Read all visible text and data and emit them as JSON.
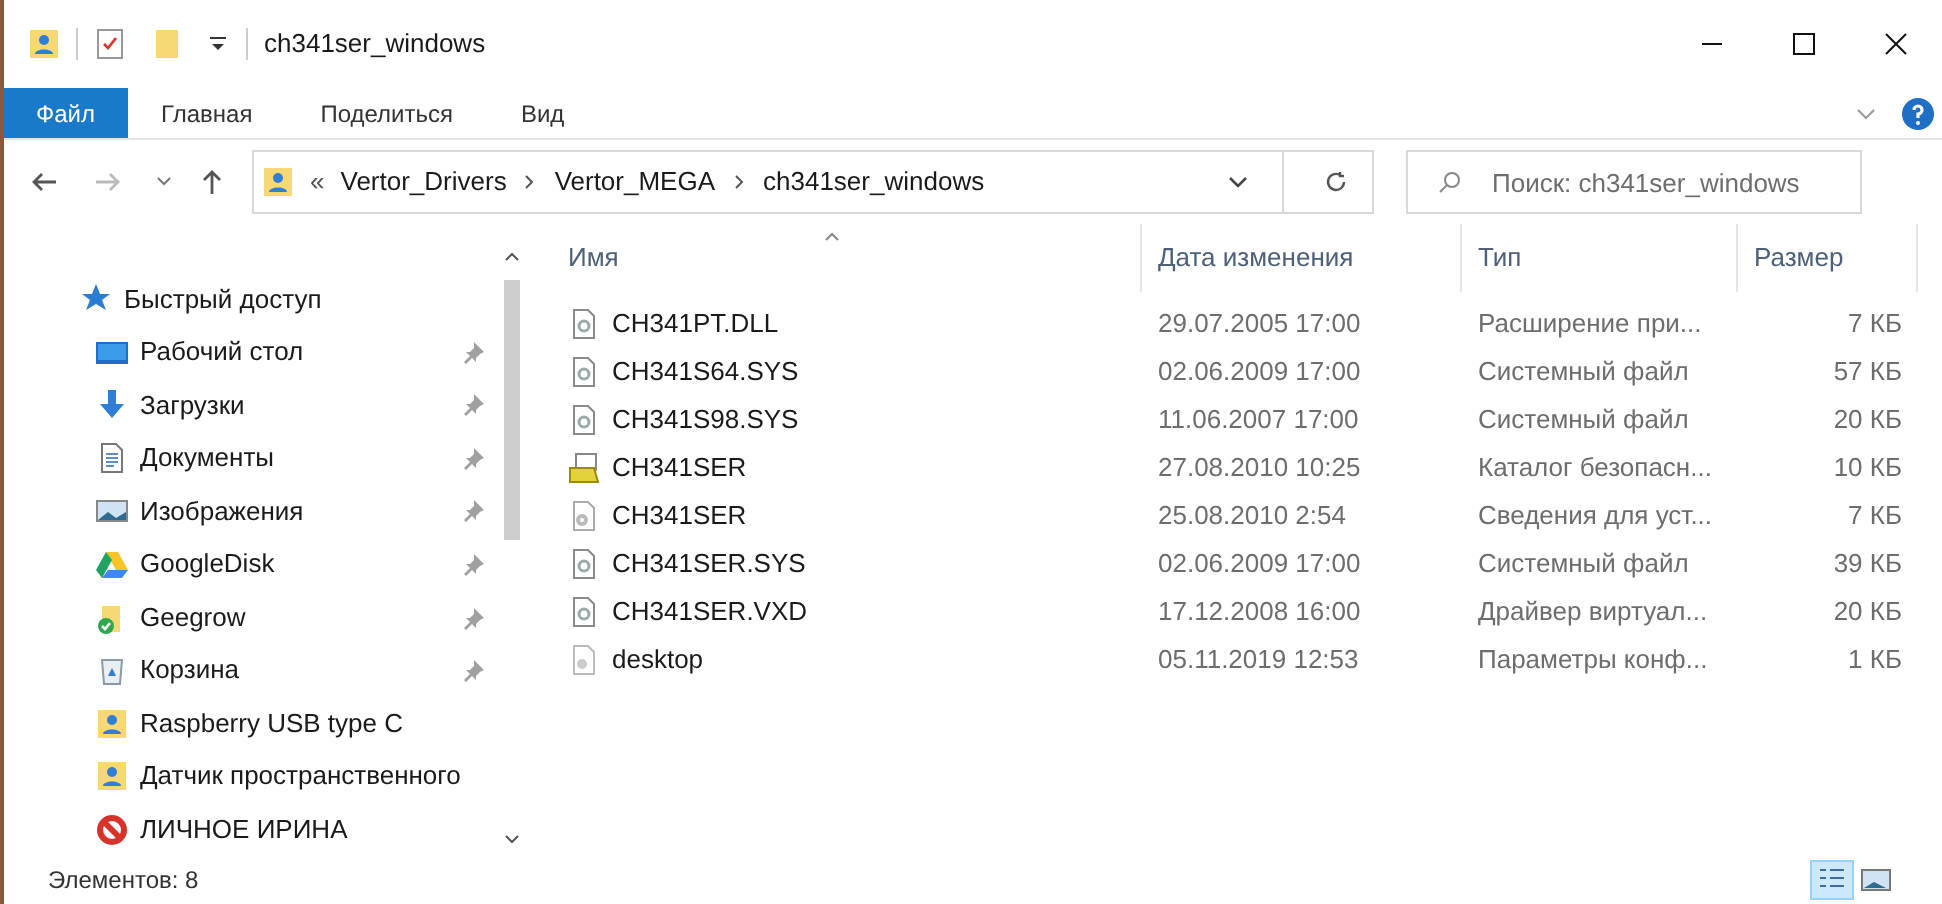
{
  "window": {
    "title": "ch341ser_windows"
  },
  "ribbon_tabs": [
    {
      "label": "Файл",
      "kind": "file"
    },
    {
      "label": "Главная",
      "kind": "tab"
    },
    {
      "label": "Поделиться",
      "kind": "tab"
    },
    {
      "label": "Вид",
      "kind": "tab"
    }
  ],
  "address": {
    "overflow": "«",
    "crumbs": [
      "Vertor_Drivers",
      "Vertor_MEGA",
      "ch341ser_windows"
    ]
  },
  "search": {
    "placeholder": "Поиск: ch341ser_windows"
  },
  "sidebar": {
    "items": [
      {
        "label": "Быстрый доступ",
        "kind": "star",
        "pinned": false
      },
      {
        "label": "Рабочий стол",
        "kind": "desktop",
        "pinned": true
      },
      {
        "label": "Загрузки",
        "kind": "download",
        "pinned": true
      },
      {
        "label": "Документы",
        "kind": "documents",
        "pinned": true
      },
      {
        "label": "Изображения",
        "kind": "images",
        "pinned": true
      },
      {
        "label": "GoogleDisk",
        "kind": "drive",
        "pinned": true
      },
      {
        "label": "Geegrow",
        "kind": "synced",
        "pinned": true
      },
      {
        "label": "Корзина",
        "kind": "recycle",
        "pinned": true
      },
      {
        "label": "Raspberry USB type C",
        "kind": "user",
        "pinned": false
      },
      {
        "label": "Датчик пространственного",
        "kind": "user",
        "pinned": false
      },
      {
        "label": "ЛИЧНОЕ ИРИНА",
        "kind": "blocked",
        "pinned": false
      }
    ]
  },
  "table": {
    "columns": [
      "Имя",
      "Дата изменения",
      "Тип",
      "Размер"
    ],
    "rows": [
      {
        "name": "CH341PT.DLL",
        "date": "29.07.2005 17:00",
        "type": "Расширение при...",
        "size": "7 КБ",
        "kind": "system"
      },
      {
        "name": "CH341S64.SYS",
        "date": "02.06.2009 17:00",
        "type": "Системный файл",
        "size": "57 КБ",
        "kind": "system"
      },
      {
        "name": "CH341S98.SYS",
        "date": "11.06.2007 17:00",
        "type": "Системный файл",
        "size": "20 КБ",
        "kind": "system"
      },
      {
        "name": "CH341SER",
        "date": "27.08.2010 10:25",
        "type": "Каталог безопасн...",
        "size": "10 КБ",
        "kind": "catalog"
      },
      {
        "name": "CH341SER",
        "date": "25.08.2010 2:54",
        "type": "Сведения для уст...",
        "size": "7 КБ",
        "kind": "setup"
      },
      {
        "name": "CH341SER.SYS",
        "date": "02.06.2009 17:00",
        "type": "Системный файл",
        "size": "39 КБ",
        "kind": "system"
      },
      {
        "name": "CH341SER.VXD",
        "date": "17.12.2008 16:00",
        "type": "Драйвер виртуал...",
        "size": "20 КБ",
        "kind": "system"
      },
      {
        "name": "desktop",
        "date": "05.11.2019 12:53",
        "type": "Параметры конф...",
        "size": "1 КБ",
        "kind": "config"
      }
    ]
  },
  "status_bar": {
    "count": "Элементов: 8"
  },
  "view_buttons": [
    {
      "kind": "details",
      "selected": true
    },
    {
      "kind": "preview",
      "selected": false
    }
  ]
}
